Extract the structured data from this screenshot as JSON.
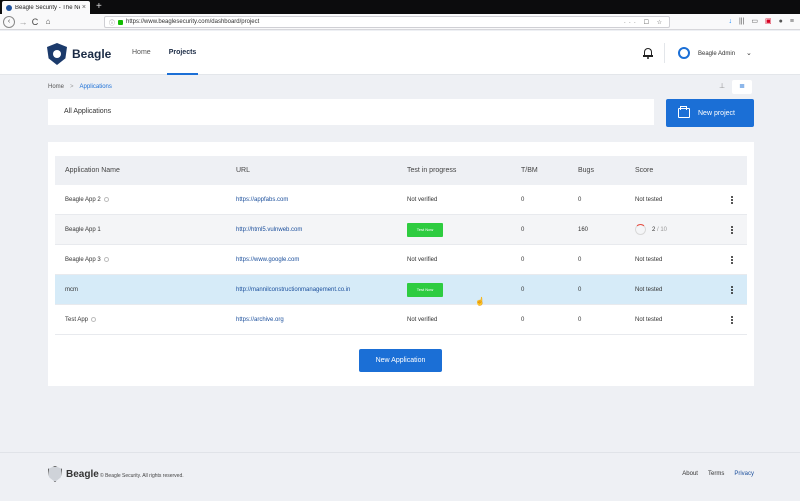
{
  "browser": {
    "tab_title": "Beagle Security - The NexGen",
    "tab_close": "×",
    "new_tab": "+",
    "url": "https://www.beaglesecurity.com/dashboard/project",
    "url_actions": "··· ☐ ☆",
    "back_icon": "‹",
    "forward_icon": "→",
    "reload_icon": "C",
    "home_icon": "⌂",
    "info_icon": "ⓘ",
    "toolbar_icons": [
      "↓",
      "|||",
      "▭",
      "▣",
      "●",
      "≡"
    ]
  },
  "header": {
    "logo_text": "Beagle",
    "nav": [
      {
        "label": "Home",
        "active": false
      },
      {
        "label": "Projects",
        "active": true
      }
    ],
    "user_name": "Beagle Admin",
    "chevron": "⌄"
  },
  "breadcrumb": {
    "home": "Home",
    "separator": ">",
    "current": "Applications"
  },
  "view_toggle": {
    "grid_icon": "⊥",
    "list_icon": "≣"
  },
  "filter": {
    "label": "All Applications"
  },
  "new_project_label": "New project",
  "table": {
    "columns": [
      "Application Name",
      "URL",
      "Test in progress",
      "T/BM",
      "Bugs",
      "Score"
    ],
    "rows": [
      {
        "name": "Beagle App 2",
        "info": true,
        "url": "https://appfabs.com",
        "status": "Not verified",
        "badge": false,
        "tbm": "0",
        "bugs": "0",
        "score": "Not tested",
        "ring": false,
        "score_sub": ""
      },
      {
        "name": "Beagle App 1",
        "info": false,
        "url": "http://html5.vulnweb.com",
        "status": "Test Now",
        "badge": true,
        "tbm": "0",
        "bugs": "160",
        "score": "2",
        "ring": true,
        "score_sub": " / 10"
      },
      {
        "name": "Beagle App 3",
        "info": true,
        "url": "https://www.google.com",
        "status": "Not verified",
        "badge": false,
        "tbm": "0",
        "bugs": "0",
        "score": "Not tested",
        "ring": false,
        "score_sub": ""
      },
      {
        "name": "mcm",
        "info": false,
        "url": "http://mannilconstructionmanagement.co.in",
        "status": "Test Now",
        "badge": true,
        "tbm": "0",
        "bugs": "0",
        "score": "Not tested",
        "ring": false,
        "score_sub": ""
      },
      {
        "name": "Test App",
        "info": true,
        "url": "https://archive.org",
        "status": "Not verified",
        "badge": false,
        "tbm": "0",
        "bugs": "0",
        "score": "Not tested",
        "ring": false,
        "score_sub": ""
      }
    ]
  },
  "new_application_label": "New Application",
  "footer": {
    "logo_text": "Beagle",
    "copyright": "© Beagle Security. All rights reserved.",
    "links": [
      "About",
      "Terms",
      "Privacy"
    ]
  },
  "colors": {
    "primary": "#1b6fd6",
    "success": "#2ecc40",
    "highlight_row": "#d6ebf8"
  }
}
